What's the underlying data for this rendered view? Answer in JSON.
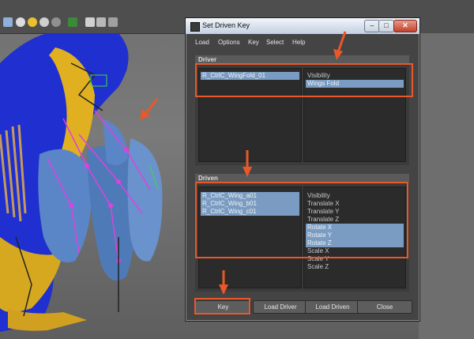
{
  "window": {
    "title": "Set Driven Key",
    "min_label": "–",
    "max_label": "□",
    "close_label": "✕"
  },
  "menu": [
    "Load",
    "Options",
    "Key",
    "Select",
    "Help"
  ],
  "driver": {
    "header": "Driver",
    "objects": [
      {
        "label": "R_CtrlC_WingFold_01",
        "selected": true
      }
    ],
    "attributes": [
      {
        "label": "Visibility",
        "selected": false
      },
      {
        "label": "Wings Fold",
        "selected": true
      }
    ]
  },
  "driven": {
    "header": "Driven",
    "objects": [
      {
        "label": "R_CtrlC_Wing_a01",
        "selected": true
      },
      {
        "label": "R_CtrlC_Wing_b01",
        "selected": true
      },
      {
        "label": "R_CtrlC_Wing_c01",
        "selected": true
      }
    ],
    "attributes": [
      {
        "label": "Visibility",
        "selected": false
      },
      {
        "label": "Translate X",
        "selected": false
      },
      {
        "label": "Translate Y",
        "selected": false
      },
      {
        "label": "Translate Z",
        "selected": false
      },
      {
        "label": "Rotate X",
        "selected": true
      },
      {
        "label": "Rotate Y",
        "selected": true
      },
      {
        "label": "Rotate Z",
        "selected": true
      },
      {
        "label": "Scale X",
        "selected": false
      },
      {
        "label": "Scale Y",
        "selected": false
      },
      {
        "label": "Scale Z",
        "selected": false
      }
    ]
  },
  "buttons": {
    "key": "Key",
    "load_driver": "Load Driver",
    "load_driven": "Load Driven",
    "close": "Close"
  },
  "colors": {
    "annotation": "#e8582a",
    "selection": "#7a9cc3",
    "bird_body": "#1f2fd0",
    "bird_beak": "#e0b020",
    "feathers": "#5a86c8",
    "joints": "#e040e0"
  }
}
